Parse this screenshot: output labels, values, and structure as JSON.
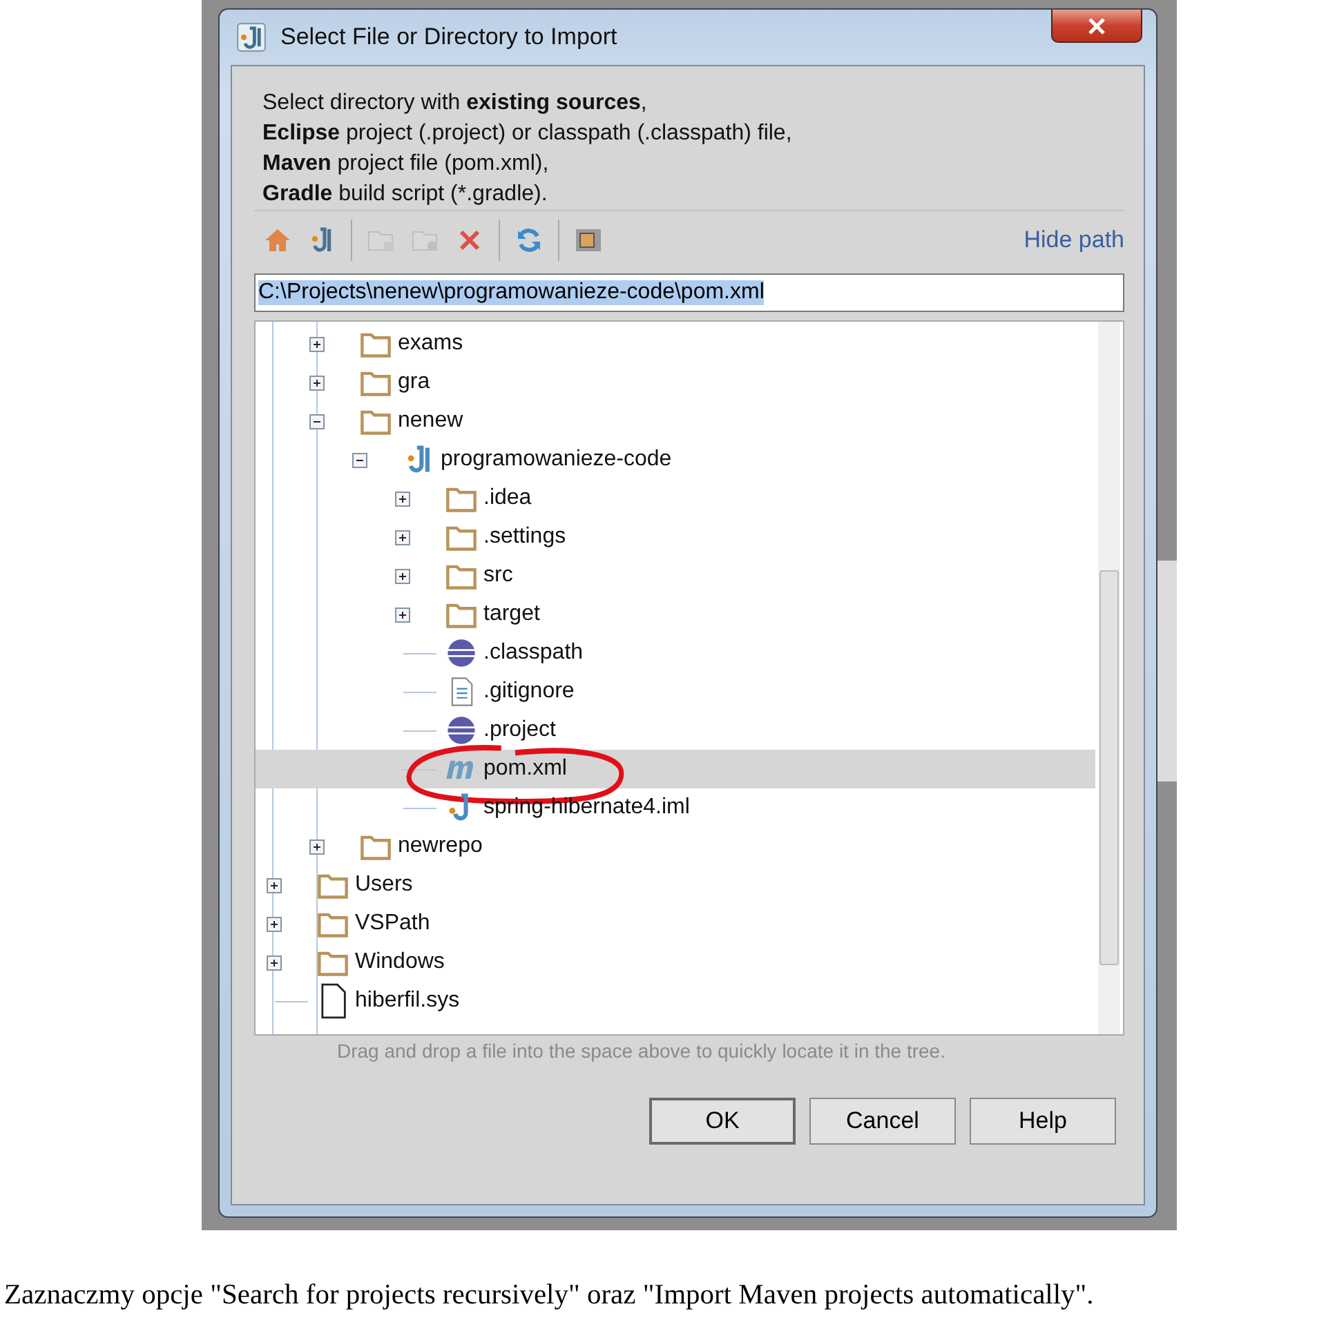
{
  "window": {
    "title": "Select File or Directory to Import"
  },
  "description": [
    "Select directory with **existing sources**,",
    "**Eclipse** project (.project) or classpath (.classpath) file,",
    "**Maven** project file (pom.xml),",
    "**Gradle** build script (*.gradle)."
  ],
  "toolbar": [
    {
      "kind": "home",
      "disabled": false
    },
    {
      "kind": "project",
      "disabled": false
    },
    {
      "kind": "new-folder",
      "disabled": true
    },
    {
      "kind": "folder-gear",
      "disabled": true
    },
    {
      "kind": "delete",
      "disabled": false
    },
    {
      "kind": "refresh",
      "disabled": false
    },
    {
      "kind": "hidden-files",
      "disabled": false
    }
  ],
  "hide_path_link": "Hide path",
  "path_field": {
    "value": "C:\\Projects\\nenew\\programowanieze-code\\pom.xml",
    "selected": true
  },
  "tree": {
    "continued_items": [
      {
        "name": "exams",
        "kind": "folder",
        "expanded": false,
        "selected": false,
        "circled": false
      },
      {
        "name": "gra",
        "kind": "folder",
        "expanded": false,
        "selected": false,
        "circled": false
      },
      {
        "name": "nenew",
        "kind": "folder",
        "expanded": true,
        "selected": false,
        "circled": false,
        "children": [
          {
            "name": "programowanieze-code",
            "kind": "project",
            "expanded": true,
            "selected": false,
            "circled": false,
            "children": [
              {
                "name": ".idea",
                "kind": "folder",
                "expanded": false,
                "selected": false,
                "circled": false
              },
              {
                "name": ".settings",
                "kind": "folder",
                "expanded": false,
                "selected": false,
                "circled": false
              },
              {
                "name": "src",
                "kind": "folder",
                "expanded": false,
                "selected": false,
                "circled": false
              },
              {
                "name": "target",
                "kind": "folder",
                "expanded": false,
                "selected": false,
                "circled": false
              },
              {
                "name": ".classpath",
                "kind": "eclipse",
                "selected": false,
                "circled": false
              },
              {
                "name": ".gitignore",
                "kind": "text",
                "selected": false,
                "circled": false
              },
              {
                "name": ".project",
                "kind": "eclipse",
                "selected": false,
                "circled": false
              },
              {
                "name": "pom.xml",
                "kind": "maven",
                "selected": true,
                "circled": true
              },
              {
                "name": "spring-hibernate4.iml",
                "kind": "module",
                "selected": false,
                "circled": false
              }
            ]
          }
        ]
      },
      {
        "name": "newrepo",
        "kind": "folder",
        "expanded": false,
        "selected": false,
        "circled": false
      }
    ],
    "items": [
      {
        "name": "Users",
        "kind": "folder",
        "expanded": false,
        "selected": false,
        "circled": false
      },
      {
        "name": "VSPath",
        "kind": "folder",
        "expanded": false,
        "selected": false,
        "circled": false
      },
      {
        "name": "Windows",
        "kind": "folder",
        "expanded": false,
        "selected": false,
        "circled": false
      },
      {
        "name": "hiberfil.sys",
        "kind": "file",
        "selected": false,
        "circled": false
      }
    ]
  },
  "hint": "Drag and drop a file into the space above to quickly locate it in the tree.",
  "buttons": [
    {
      "label": "OK",
      "default": true
    },
    {
      "label": "Cancel",
      "default": false
    },
    {
      "label": "Help",
      "default": false
    }
  ],
  "caption": "Zaznaczmy opcje \"Search for projects recursively\" oraz \"Import Maven projects automatically\"."
}
